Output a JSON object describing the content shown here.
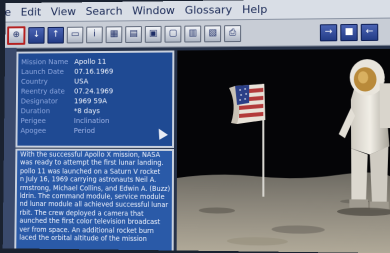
{
  "menu": [
    "le",
    "Edit",
    "View",
    "Search",
    "Window",
    "Glossary",
    "Help"
  ],
  "toolbar": {
    "left_buttons": [
      "magnify-icon",
      "down-arrow-icon",
      "up-arrow-icon",
      "folder-icon",
      "info-icon",
      "grid-icon",
      "table-icon",
      "image-icon",
      "document-icon",
      "book-icon",
      "page-icon",
      "print-icon"
    ],
    "left_glyphs": [
      "⊕",
      "↓",
      "↑",
      "▭",
      "i",
      "▦",
      "▤",
      "▣",
      "▢",
      "▥",
      "▧",
      "⎙"
    ],
    "right_buttons": [
      "forward-icon",
      "stop-icon",
      "back-icon"
    ],
    "right_glyphs": [
      "→",
      "■",
      "←"
    ]
  },
  "info": {
    "rows": [
      {
        "key": "Mission Name",
        "value": "Apollo 11"
      },
      {
        "key": "Launch Date",
        "value": "07.16.1969"
      },
      {
        "key": "Country",
        "value": "USA"
      },
      {
        "key": "Reentry date",
        "value": "07.24.1969"
      },
      {
        "key": "Designator",
        "value": "1969 59A"
      },
      {
        "key": "Duration",
        "value": "*8 days"
      },
      {
        "key": "Perigee",
        "value": "Inclination"
      },
      {
        "key": "Apogee",
        "value": "Period"
      }
    ]
  },
  "description": [
    "With the successful Apollo X mission, NASA",
    "was ready to attempt the first lunar landing.",
    "pollo 11 was launched on a Saturn V rocket",
    "n July 16, 1969 carrying astronauts Neil A.",
    "rmstrong, Michael Collins, and Edwin A. (Buzz)",
    "ldrin. The command module, service module",
    "nd lunar module all achieved successful lunar",
    "rbit. The crew deployed a camera that",
    "aunched the first color television broadcast",
    "ver from space. An additional rocket burn",
    "laced the orbital altitude of the mission"
  ],
  "colors": {
    "info_bg": "#1f4a93",
    "text_bg": "#2a5aa8",
    "menubar_bg": "#d9dee6",
    "toolbar_bg": "#c8cdd6"
  }
}
